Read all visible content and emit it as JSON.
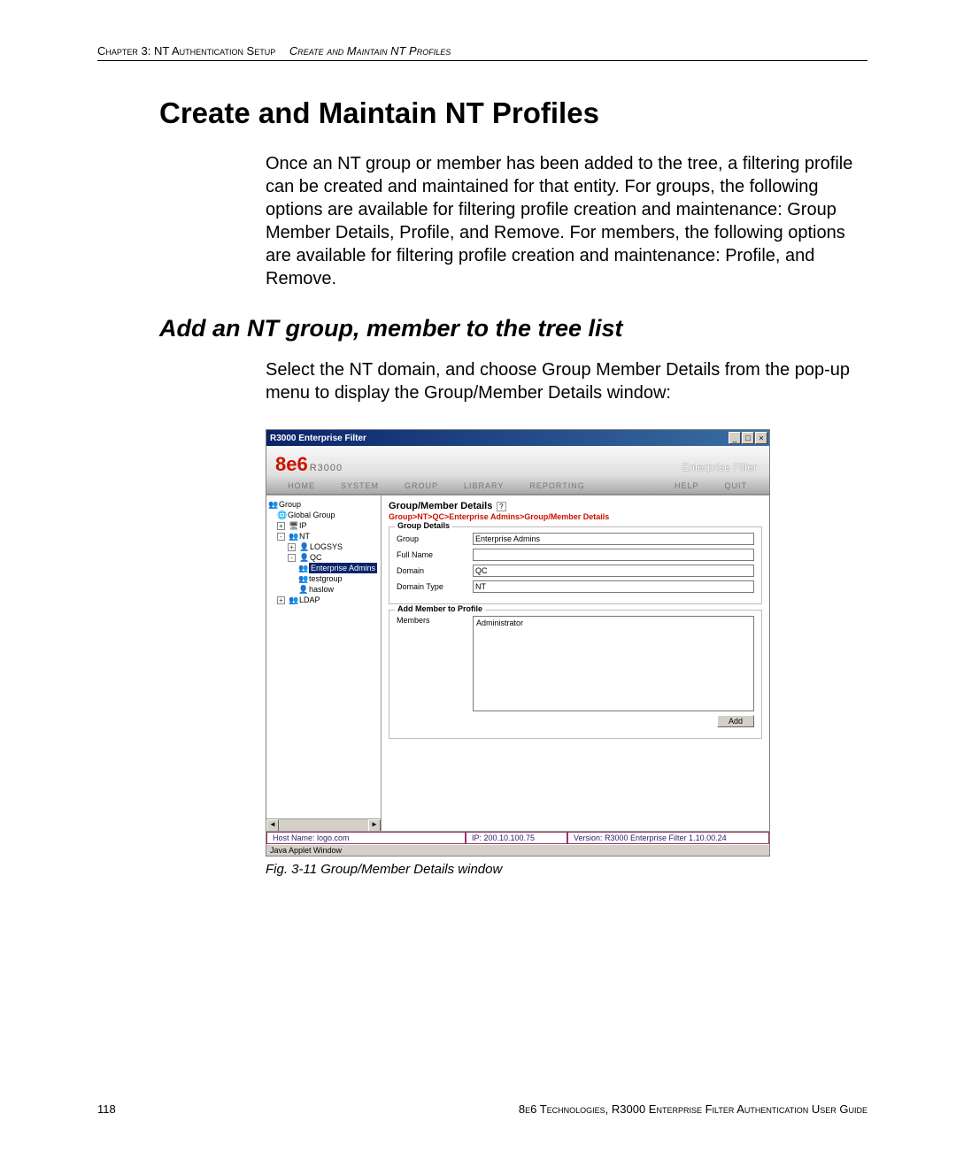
{
  "header": {
    "left": "Chapter 3: NT Authentication Setup",
    "right": "Create and Maintain NT Profiles"
  },
  "heading": "Create and Maintain NT Profiles",
  "intro": "Once an NT group or member has been added to the tree, a filtering profile can be created and maintained for that entity. For groups, the following options are available for filtering profile creation and maintenance: Group Member Details, Profile, and Remove. For members, the following options are available for filtering profile creation and maintenance: Profile, and Remove.",
  "subheading": "Add an NT group, member to the tree list",
  "subtext": "Select the NT domain, and choose Group Member Details from the pop-up menu to display the Group/Member Details window:",
  "caption": "Fig. 3-11  Group/Member Details window",
  "footer": {
    "page": "118",
    "right": "8e6 Technologies, R3000 Enterprise Filter Authentication User Guide"
  },
  "app": {
    "title": "R3000 Enterprise Filter",
    "brand_8e6": "8e6",
    "brand_r3000": "R3000",
    "brand_ent": "Enterprise Filter",
    "nav": {
      "home": "HOME",
      "system": "SYSTEM",
      "group": "GROUP",
      "library": "LIBRARY",
      "reporting": "REPORTING",
      "help": "HELP",
      "quit": "QUIT"
    },
    "tree": {
      "root": "Group",
      "global": "Global Group",
      "ip": "IP",
      "nt": "NT",
      "logsys": "LOGSYS",
      "qc": "QC",
      "sel": "Enterprise Admins",
      "testgroup": "testgroup",
      "haslow": "haslow",
      "ldap": "LDAP"
    },
    "detail": {
      "title": "Group/Member Details",
      "help": "?",
      "crumb": "Group>NT>QC>Enterprise Admins>Group/Member Details",
      "legend1": "Group Details",
      "l_group": "Group",
      "v_group": "Enterprise Admins",
      "l_fullname": "Full Name",
      "v_fullname": "",
      "l_domain": "Domain",
      "v_domain": "QC",
      "l_domaintype": "Domain Type",
      "v_domaintype": "NT",
      "legend2": "Add Member to Profile",
      "l_members": "Members",
      "member1": "Administrator",
      "add": "Add"
    },
    "status": {
      "host": "Host Name: logo.com",
      "ip": "IP: 200.10.100.75",
      "ver": "Version: R3000 Enterprise Filter 1.10.00.24"
    },
    "applet": "Java Applet Window"
  }
}
